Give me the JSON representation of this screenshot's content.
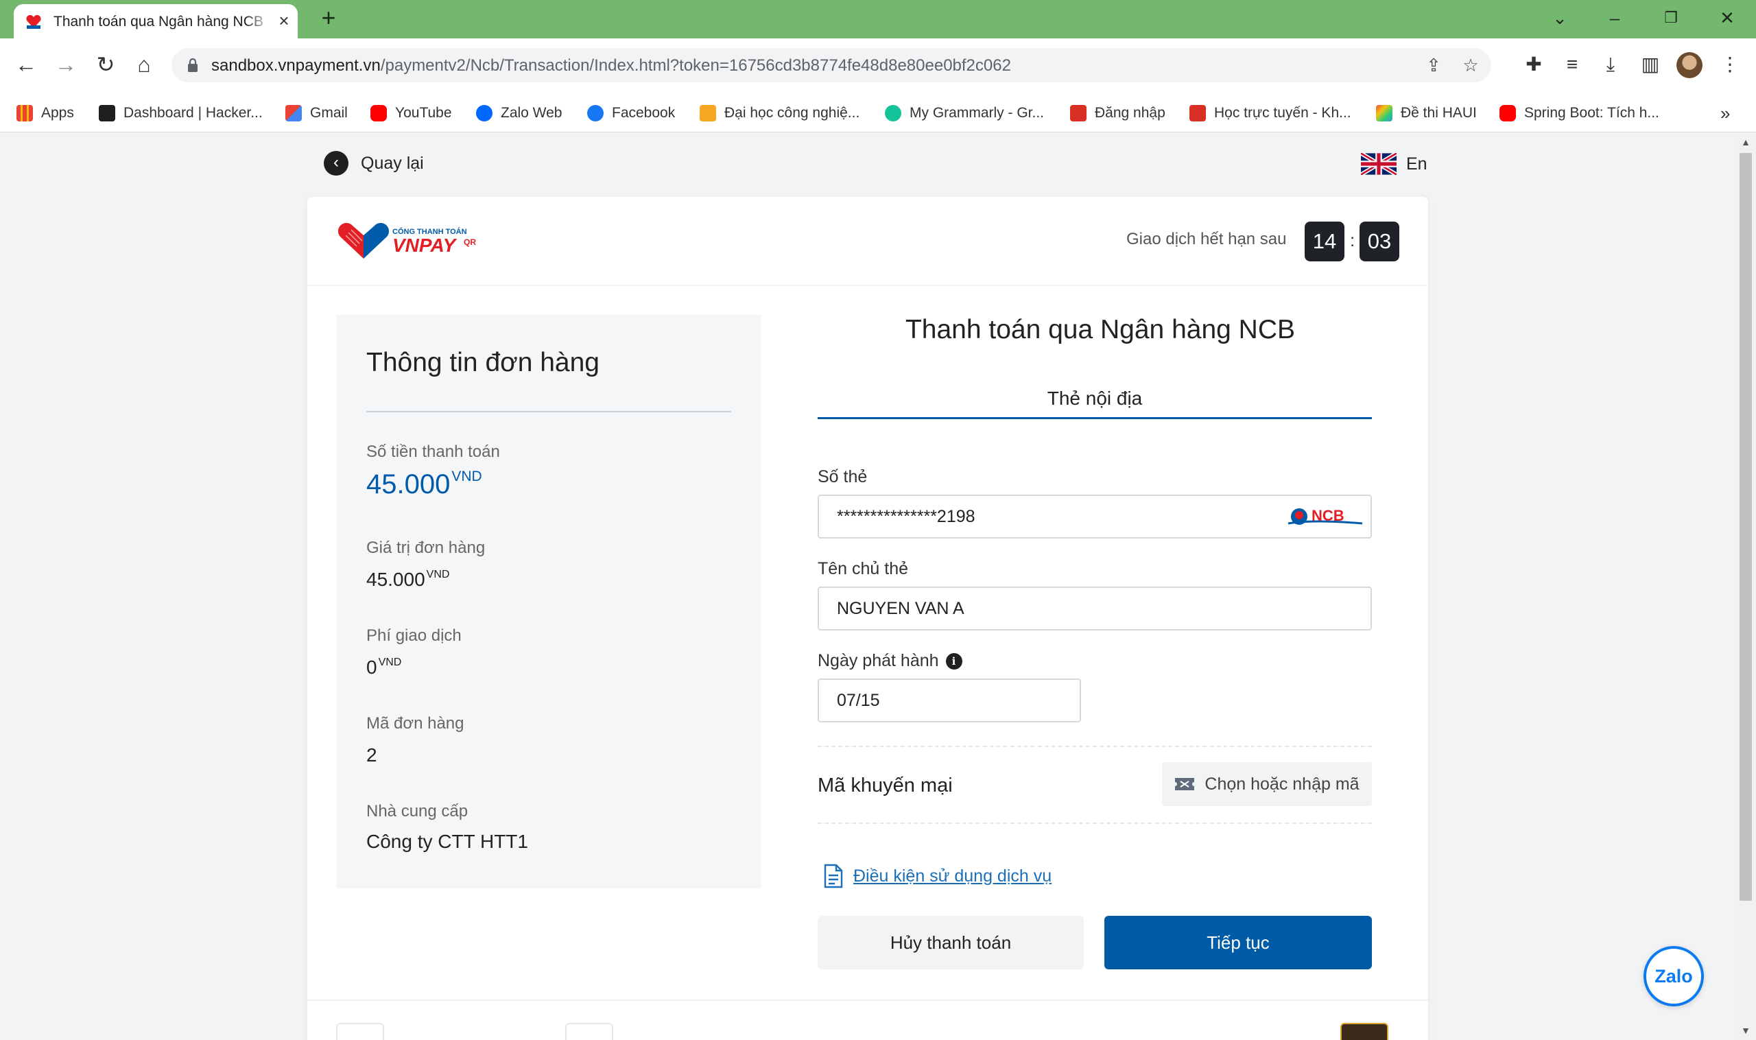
{
  "browser": {
    "tab_title": "Thanh toán qua Ngân hàng NCB",
    "new_tab": "+",
    "url_domain": "sandbox.vnpayment.vn",
    "url_path": "/paymentv2/Ncb/Transaction/Index.html?token=16756cd3b8774fe48d8e80ee0bf2c062",
    "bookmarks": [
      {
        "label": "Apps",
        "icon": "apps-grid-icon",
        "color": "#4285f4"
      },
      {
        "label": "Dashboard | Hacker...",
        "icon": "hackerrank-icon",
        "color": "#1f1f1f"
      },
      {
        "label": "Gmail",
        "icon": "gmail-icon",
        "color": "#ea4335"
      },
      {
        "label": "YouTube",
        "icon": "youtube-icon",
        "color": "#ff0000"
      },
      {
        "label": "Zalo Web",
        "icon": "zalo-icon",
        "color": "#0068ff"
      },
      {
        "label": "Facebook",
        "icon": "facebook-icon",
        "color": "#1877f2"
      },
      {
        "label": "Đại học công nghiệ...",
        "icon": "university-icon",
        "color": "#f5a623"
      },
      {
        "label": "My Grammarly - Gr...",
        "icon": "grammarly-icon",
        "color": "#15c39a"
      },
      {
        "label": "Đăng nhập",
        "icon": "code-icon",
        "color": "#d93025"
      },
      {
        "label": "Học trực tuyến - Kh...",
        "icon": "code-icon",
        "color": "#d93025"
      },
      {
        "label": "Đề thi HAUI",
        "icon": "colorful-icon",
        "color": "#8e44ad"
      },
      {
        "label": "Spring Boot: Tích h...",
        "icon": "youtube-icon",
        "color": "#ff0000"
      }
    ],
    "bookmarks_more": "»"
  },
  "page": {
    "back_label": "Quay lại",
    "lang_label": "En",
    "logo_top_text": "CỔNG THANH TOÁN",
    "logo_brand": "VNPAY",
    "logo_qr": "QR",
    "timer_label": "Giao dịch hết hạn sau",
    "timer_minutes": "14",
    "timer_sep": ":",
    "timer_seconds": "03",
    "order": {
      "title": "Thông tin đơn hàng",
      "amount_label": "Số tiền thanh toán",
      "amount_value": "45.000",
      "amount_unit": "VND",
      "order_value_label": "Giá trị đơn hàng",
      "order_value": "45.000",
      "order_value_unit": "VND",
      "fee_label": "Phí giao dịch",
      "fee_value": "0",
      "fee_unit": "VND",
      "order_id_label": "Mã đơn hàng",
      "order_id": "2",
      "provider_label": "Nhà cung cấp",
      "provider": "Công ty CTT HTT1"
    },
    "payment": {
      "title": "Thanh toán qua Ngân hàng NCB",
      "tab": "Thẻ nội địa",
      "card_number_label": "Số thẻ",
      "card_number": "***************2198",
      "bank_logo_text": "NCB",
      "holder_label": "Tên chủ thẻ",
      "holder_name": "NGUYEN VAN A",
      "issue_date_label": "Ngày phát hành",
      "issue_date": "07/15",
      "promo_label": "Mã khuyến mại",
      "promo_button": "Chọn hoặc nhập mã",
      "terms_link": "Điều kiện sử dụng dịch vụ",
      "cancel_button": "Hủy thanh toán",
      "continue_button": "Tiếp tục"
    },
    "zalo_label": "Zalo",
    "colors": {
      "primary": "#005ba6",
      "tabstrip": "#74b86f",
      "timer_bg": "#1f2327"
    }
  }
}
